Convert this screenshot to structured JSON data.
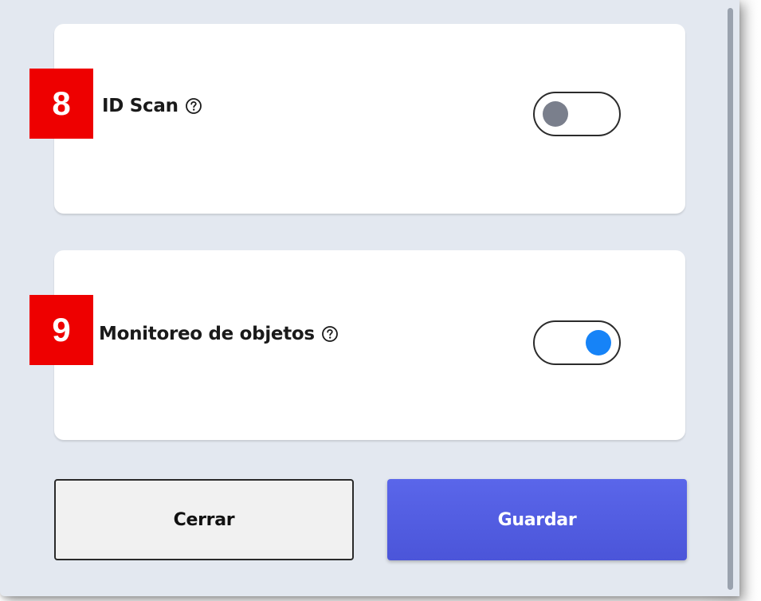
{
  "settings": [
    {
      "badge": "8",
      "label": "ID Scan",
      "help_icon": "question-circle-icon",
      "toggle_state": "off"
    },
    {
      "badge": "9",
      "label": "Monitoreo de objetos",
      "help_icon": "question-circle-icon",
      "toggle_state": "on"
    }
  ],
  "buttons": {
    "close_label": "Cerrar",
    "save_label": "Guardar"
  },
  "colors": {
    "badge_red": "#ee0000",
    "toggle_on": "#1683f7",
    "toggle_off": "#7a7f8c",
    "primary_button": "#4f5ae0",
    "panel_background": "#e3e8f0"
  }
}
